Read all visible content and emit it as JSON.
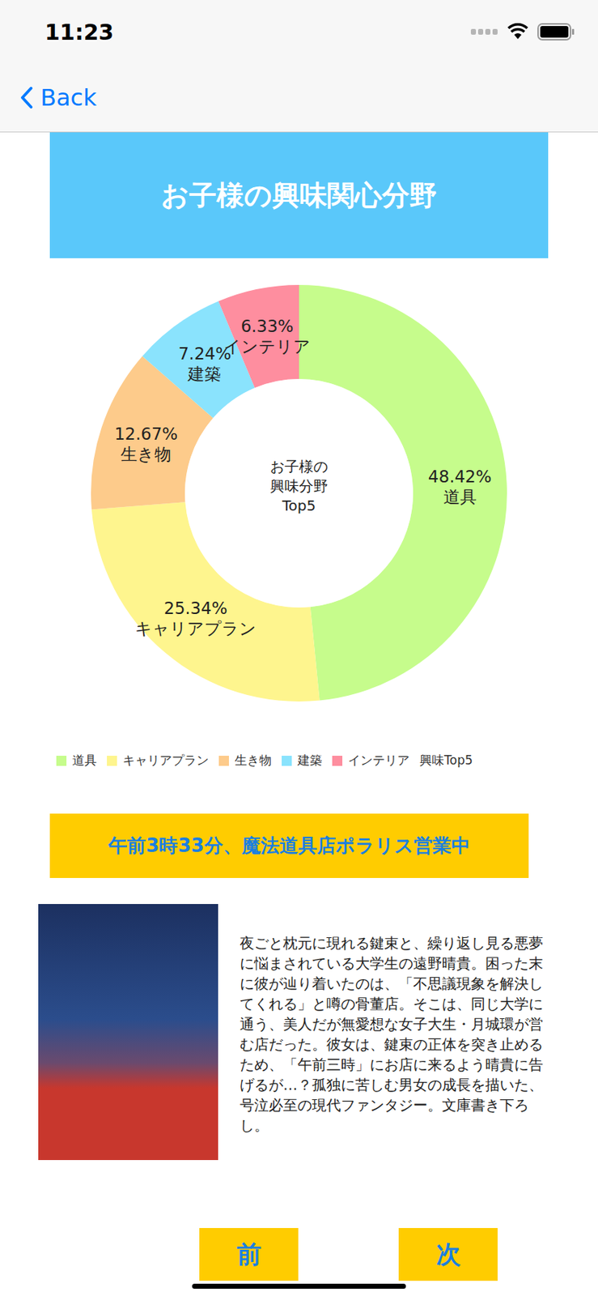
{
  "status_bar": {
    "time": "11:23"
  },
  "nav": {
    "back": "Back"
  },
  "header": {
    "title": "お子様の興味関心分野"
  },
  "chart": {
    "center_label": [
      "お子様の",
      "興味分野",
      "Top5"
    ],
    "series": [
      {
        "label": "道具",
        "value": 48.42,
        "reading": "48.42%",
        "color": "#c6fc8c"
      },
      {
        "label": "キャリアプラン",
        "value": 25.34,
        "reading": "25.34%",
        "color": "#fef58e"
      },
      {
        "label": "生き物",
        "value": 12.67,
        "reading": "12.67%",
        "color": "#fdcb8b"
      },
      {
        "label": "建築",
        "value": 7.24,
        "reading": "7.24%",
        "color": "#8ae3fd"
      },
      {
        "label": "インテリア",
        "value": 6.33,
        "reading": "6.33%",
        "color": "#fe8e9f"
      }
    ]
  },
  "legend": {
    "items": [
      {
        "label": "道具",
        "color": "#c6fc8c"
      },
      {
        "label": "キャリアプラン",
        "color": "#fef58e"
      },
      {
        "label": "生き物",
        "color": "#fdcb8b"
      },
      {
        "label": "建築",
        "color": "#8ae3fd"
      },
      {
        "label": "インテリア",
        "color": "#fe8e9f"
      }
    ],
    "title": "興味Top5"
  },
  "book": {
    "title": "午前3時33分、魔法道具店ポラリス営業中",
    "description": "夜ごと枕元に現れる鍵束と、繰り返し見る悪夢に悩まされている大学生の遠野晴貴。困った末に彼が辿り着いたのは、「不思議現象を解決してくれる」と噂の骨董店。そこは、同じ大学に通う、美人だが無愛想な女子大生・月城環が営む店だった。彼女は、鍵束の正体を突き止めるため、「午前三時」にお店に来るよう晴貴に告げるが…？孤独に苦しむ男女の成長を描いた、号泣必至の現代ファンタジー。文庫書き下ろし。"
  },
  "buttons": [
    {
      "label": "前"
    },
    {
      "label": "次"
    }
  ]
}
